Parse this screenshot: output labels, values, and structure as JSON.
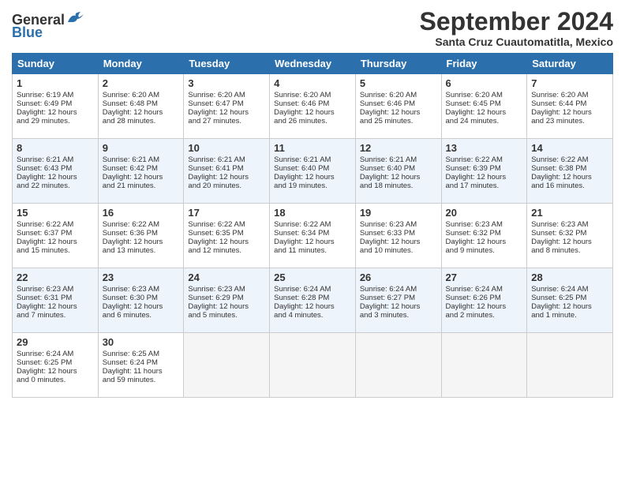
{
  "header": {
    "logo_general": "General",
    "logo_blue": "Blue",
    "title": "September 2024",
    "location": "Santa Cruz Cuautomatitla, Mexico"
  },
  "days_of_week": [
    "Sunday",
    "Monday",
    "Tuesday",
    "Wednesday",
    "Thursday",
    "Friday",
    "Saturday"
  ],
  "weeks": [
    [
      {
        "day": "1",
        "lines": [
          "Sunrise: 6:19 AM",
          "Sunset: 6:49 PM",
          "Daylight: 12 hours",
          "and 29 minutes."
        ]
      },
      {
        "day": "2",
        "lines": [
          "Sunrise: 6:20 AM",
          "Sunset: 6:48 PM",
          "Daylight: 12 hours",
          "and 28 minutes."
        ]
      },
      {
        "day": "3",
        "lines": [
          "Sunrise: 6:20 AM",
          "Sunset: 6:47 PM",
          "Daylight: 12 hours",
          "and 27 minutes."
        ]
      },
      {
        "day": "4",
        "lines": [
          "Sunrise: 6:20 AM",
          "Sunset: 6:46 PM",
          "Daylight: 12 hours",
          "and 26 minutes."
        ]
      },
      {
        "day": "5",
        "lines": [
          "Sunrise: 6:20 AM",
          "Sunset: 6:46 PM",
          "Daylight: 12 hours",
          "and 25 minutes."
        ]
      },
      {
        "day": "6",
        "lines": [
          "Sunrise: 6:20 AM",
          "Sunset: 6:45 PM",
          "Daylight: 12 hours",
          "and 24 minutes."
        ]
      },
      {
        "day": "7",
        "lines": [
          "Sunrise: 6:20 AM",
          "Sunset: 6:44 PM",
          "Daylight: 12 hours",
          "and 23 minutes."
        ]
      }
    ],
    [
      {
        "day": "8",
        "lines": [
          "Sunrise: 6:21 AM",
          "Sunset: 6:43 PM",
          "Daylight: 12 hours",
          "and 22 minutes."
        ]
      },
      {
        "day": "9",
        "lines": [
          "Sunrise: 6:21 AM",
          "Sunset: 6:42 PM",
          "Daylight: 12 hours",
          "and 21 minutes."
        ]
      },
      {
        "day": "10",
        "lines": [
          "Sunrise: 6:21 AM",
          "Sunset: 6:41 PM",
          "Daylight: 12 hours",
          "and 20 minutes."
        ]
      },
      {
        "day": "11",
        "lines": [
          "Sunrise: 6:21 AM",
          "Sunset: 6:40 PM",
          "Daylight: 12 hours",
          "and 19 minutes."
        ]
      },
      {
        "day": "12",
        "lines": [
          "Sunrise: 6:21 AM",
          "Sunset: 6:40 PM",
          "Daylight: 12 hours",
          "and 18 minutes."
        ]
      },
      {
        "day": "13",
        "lines": [
          "Sunrise: 6:22 AM",
          "Sunset: 6:39 PM",
          "Daylight: 12 hours",
          "and 17 minutes."
        ]
      },
      {
        "day": "14",
        "lines": [
          "Sunrise: 6:22 AM",
          "Sunset: 6:38 PM",
          "Daylight: 12 hours",
          "and 16 minutes."
        ]
      }
    ],
    [
      {
        "day": "15",
        "lines": [
          "Sunrise: 6:22 AM",
          "Sunset: 6:37 PM",
          "Daylight: 12 hours",
          "and 15 minutes."
        ]
      },
      {
        "day": "16",
        "lines": [
          "Sunrise: 6:22 AM",
          "Sunset: 6:36 PM",
          "Daylight: 12 hours",
          "and 13 minutes."
        ]
      },
      {
        "day": "17",
        "lines": [
          "Sunrise: 6:22 AM",
          "Sunset: 6:35 PM",
          "Daylight: 12 hours",
          "and 12 minutes."
        ]
      },
      {
        "day": "18",
        "lines": [
          "Sunrise: 6:22 AM",
          "Sunset: 6:34 PM",
          "Daylight: 12 hours",
          "and 11 minutes."
        ]
      },
      {
        "day": "19",
        "lines": [
          "Sunrise: 6:23 AM",
          "Sunset: 6:33 PM",
          "Daylight: 12 hours",
          "and 10 minutes."
        ]
      },
      {
        "day": "20",
        "lines": [
          "Sunrise: 6:23 AM",
          "Sunset: 6:32 PM",
          "Daylight: 12 hours",
          "and 9 minutes."
        ]
      },
      {
        "day": "21",
        "lines": [
          "Sunrise: 6:23 AM",
          "Sunset: 6:32 PM",
          "Daylight: 12 hours",
          "and 8 minutes."
        ]
      }
    ],
    [
      {
        "day": "22",
        "lines": [
          "Sunrise: 6:23 AM",
          "Sunset: 6:31 PM",
          "Daylight: 12 hours",
          "and 7 minutes."
        ]
      },
      {
        "day": "23",
        "lines": [
          "Sunrise: 6:23 AM",
          "Sunset: 6:30 PM",
          "Daylight: 12 hours",
          "and 6 minutes."
        ]
      },
      {
        "day": "24",
        "lines": [
          "Sunrise: 6:23 AM",
          "Sunset: 6:29 PM",
          "Daylight: 12 hours",
          "and 5 minutes."
        ]
      },
      {
        "day": "25",
        "lines": [
          "Sunrise: 6:24 AM",
          "Sunset: 6:28 PM",
          "Daylight: 12 hours",
          "and 4 minutes."
        ]
      },
      {
        "day": "26",
        "lines": [
          "Sunrise: 6:24 AM",
          "Sunset: 6:27 PM",
          "Daylight: 12 hours",
          "and 3 minutes."
        ]
      },
      {
        "day": "27",
        "lines": [
          "Sunrise: 6:24 AM",
          "Sunset: 6:26 PM",
          "Daylight: 12 hours",
          "and 2 minutes."
        ]
      },
      {
        "day": "28",
        "lines": [
          "Sunrise: 6:24 AM",
          "Sunset: 6:25 PM",
          "Daylight: 12 hours",
          "and 1 minute."
        ]
      }
    ],
    [
      {
        "day": "29",
        "lines": [
          "Sunrise: 6:24 AM",
          "Sunset: 6:25 PM",
          "Daylight: 12 hours",
          "and 0 minutes."
        ]
      },
      {
        "day": "30",
        "lines": [
          "Sunrise: 6:25 AM",
          "Sunset: 6:24 PM",
          "Daylight: 11 hours",
          "and 59 minutes."
        ]
      },
      null,
      null,
      null,
      null,
      null
    ]
  ]
}
